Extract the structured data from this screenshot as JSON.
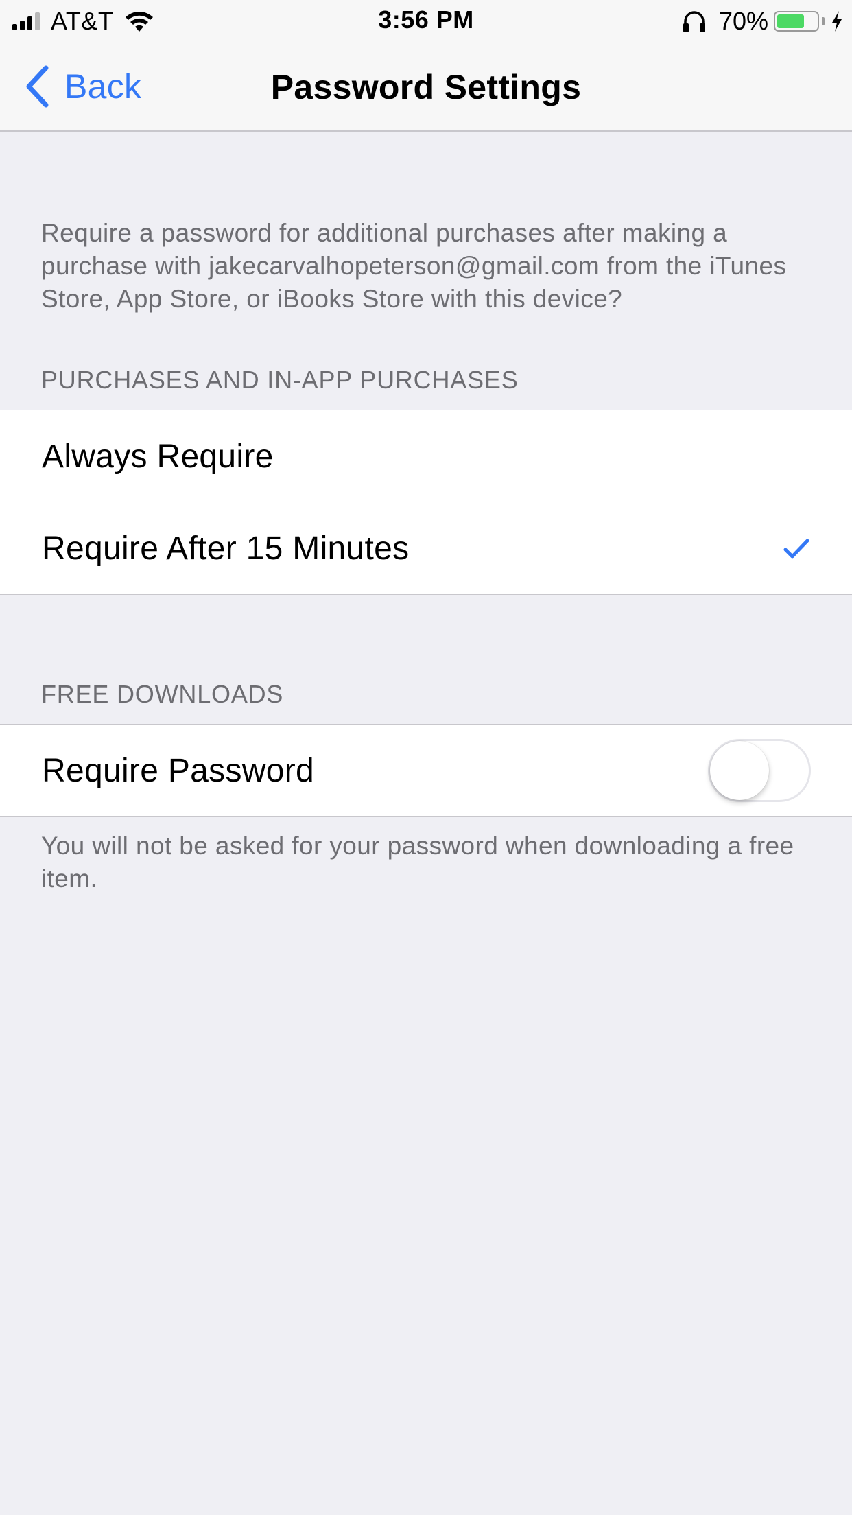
{
  "status_bar": {
    "carrier": "AT&T",
    "time": "3:56 PM",
    "battery_percent": "70%",
    "battery_level": 0.7,
    "signal_bars_filled": 3,
    "signal_bars_total": 4,
    "icons": [
      "signal-icon",
      "wifi-icon",
      "headphones-icon",
      "battery-icon",
      "charging-bolt-icon"
    ]
  },
  "nav": {
    "back_label": "Back",
    "title": "Password Settings"
  },
  "description": "Require a password for additional purchases after making a purchase with jakecarvalhopeterson@gmail.com from the iTunes Store, App Store, or iBooks Store with this device?",
  "purchases_section": {
    "header": "PURCHASES AND IN-APP PURCHASES",
    "options": [
      {
        "label": "Always Require",
        "selected": false
      },
      {
        "label": "Require After 15 Minutes",
        "selected": true
      }
    ]
  },
  "free_downloads_section": {
    "header": "FREE DOWNLOADS",
    "require_password_label": "Require Password",
    "require_password_on": false,
    "footer": "You will not be asked for your password when downloading a free item."
  },
  "colors": {
    "accent": "#3478F6",
    "background": "#EFEFF4",
    "secondary_text": "#6D6D72",
    "separator": "#C8C7CC",
    "battery_green": "#4CD964"
  }
}
